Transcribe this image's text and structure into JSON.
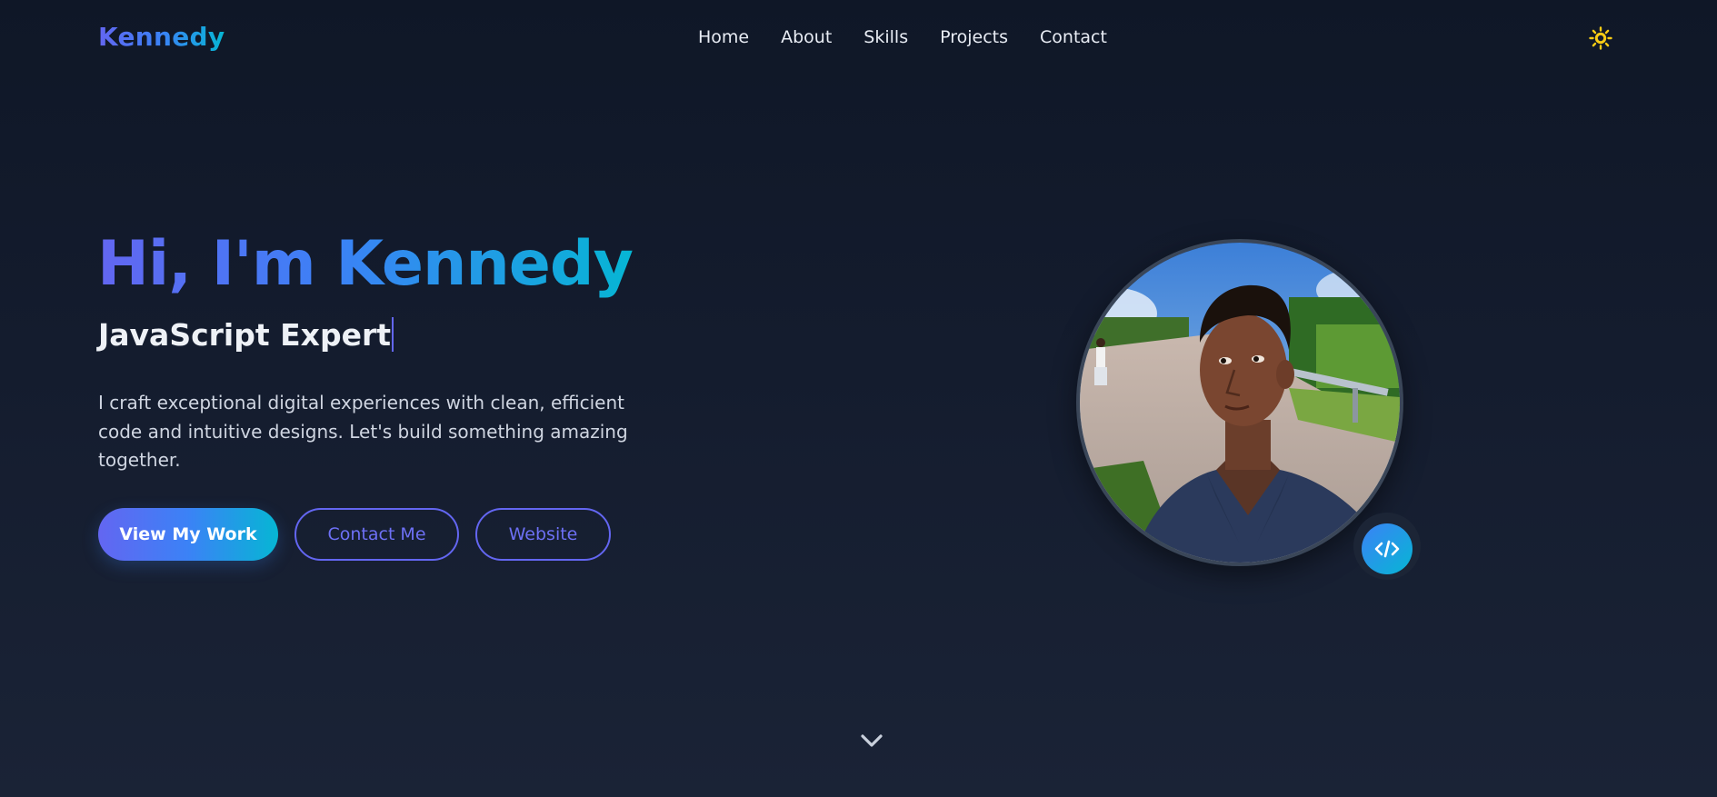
{
  "nav": {
    "logo": "Kennedy",
    "links": [
      {
        "label": "Home"
      },
      {
        "label": "About"
      },
      {
        "label": "Skills"
      },
      {
        "label": "Projects"
      },
      {
        "label": "Contact"
      }
    ],
    "theme_icon": "sun-icon"
  },
  "hero": {
    "title": "Hi, I'm Kennedy",
    "subtitle": "JavaScript Expert",
    "description": "I craft exceptional digital experiences with clean, efficient code and intuitive designs. Let's build something amazing together.",
    "buttons": {
      "primary": "View My Work",
      "contact": "Contact Me",
      "website": "Website"
    },
    "avatar_icon": "profile-photo",
    "badge_icon": "code-icon",
    "scroll_icon": "chevron-down-icon"
  },
  "colors": {
    "background": "#141c2e",
    "accent_indigo": "#6366f1",
    "accent_blue": "#3b82f6",
    "accent_cyan": "#06b6d4",
    "sun": "#facc15"
  }
}
